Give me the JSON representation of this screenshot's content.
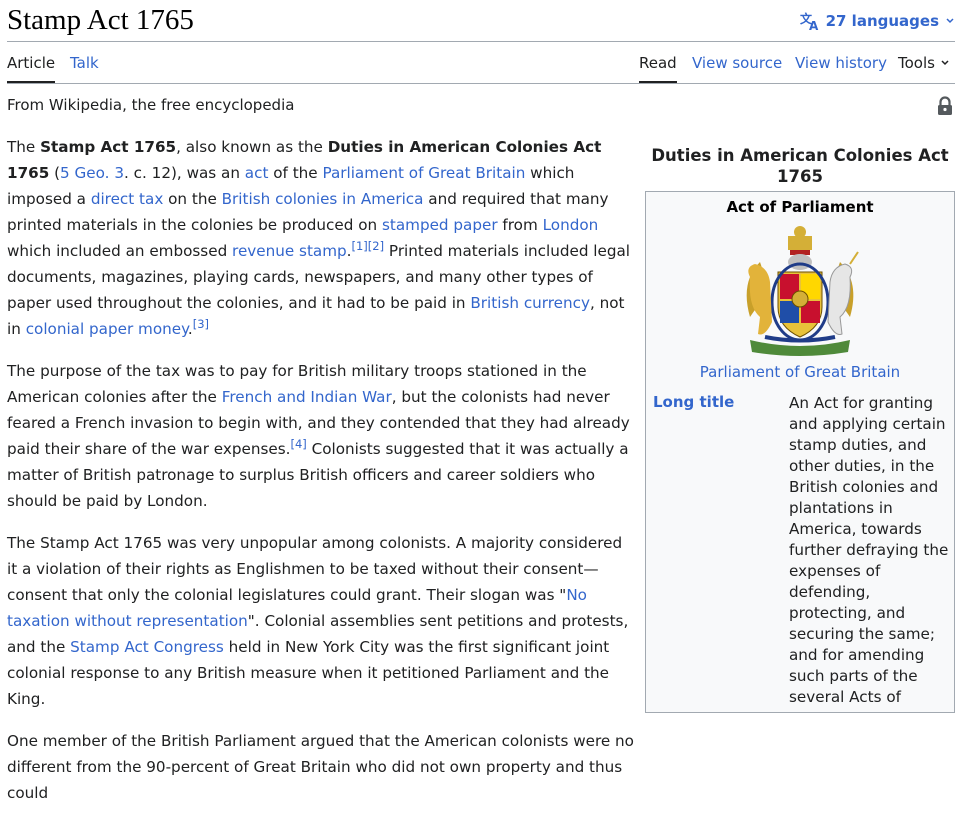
{
  "header": {
    "title": "Stamp Act 1765",
    "languages_label": "27 languages"
  },
  "tabs": {
    "article": "Article",
    "talk": "Talk",
    "read": "Read",
    "view_source": "View source",
    "view_history": "View history",
    "tools": "Tools"
  },
  "tagline": "From Wikipedia, the free encyclopedia",
  "icons": {
    "translate": "translate-icon",
    "chevron": "chevron-down-icon",
    "lock": "lock-icon",
    "coat_of_arms": "coat-of-arms-icon"
  },
  "colors": {
    "link": "#3366cc",
    "text": "#202122",
    "border": "#a2a9b1",
    "infobox_bg": "#f8f9fa"
  },
  "article": {
    "p1": [
      {
        "t": "The "
      },
      {
        "t": "Stamp Act 1765",
        "b": true
      },
      {
        "t": ", also known as the "
      },
      {
        "t": "Duties in American Colonies Act 1765",
        "b": true
      },
      {
        "t": " ("
      },
      {
        "t": "5 Geo. 3",
        "l": true
      },
      {
        "t": ". c. 12), was an "
      },
      {
        "t": "act",
        "l": true
      },
      {
        "t": " of the "
      },
      {
        "t": "Parliament of Great Britain",
        "l": true
      },
      {
        "t": " which imposed a "
      },
      {
        "t": "direct tax",
        "l": true
      },
      {
        "t": " on the "
      },
      {
        "t": "British colonies in America",
        "l": true
      },
      {
        "t": " and required that many printed materials in the colonies be produced on "
      },
      {
        "t": "stamped paper",
        "l": true
      },
      {
        "t": " from "
      },
      {
        "t": "London",
        "l": true
      },
      {
        "t": " which included an embossed "
      },
      {
        "t": "revenue stamp",
        "l": true
      },
      {
        "t": "."
      },
      {
        "t": "[1]",
        "sup": true
      },
      {
        "t": "[2]",
        "sup": true
      },
      {
        "t": " Printed materials included legal documents, magazines, playing cards, newspapers, and many other types of paper used throughout the colonies, and it had to be paid in "
      },
      {
        "t": "British currency",
        "l": true
      },
      {
        "t": ", not in "
      },
      {
        "t": "colonial paper money",
        "l": true
      },
      {
        "t": "."
      },
      {
        "t": "[3]",
        "sup": true
      }
    ],
    "p2": [
      {
        "t": "The purpose of the tax was to pay for British military troops stationed in the American colonies after the "
      },
      {
        "t": "French and Indian War",
        "l": true
      },
      {
        "t": ", but the colonists had never feared a French invasion to begin with, and they contended that they had already paid their share of the war expenses."
      },
      {
        "t": "[4]",
        "sup": true
      },
      {
        "t": " Colonists suggested that it was actually a matter of British patronage to surplus British officers and career soldiers who should be paid by London."
      }
    ],
    "p3": [
      {
        "t": "The Stamp Act 1765 was very unpopular among colonists. A majority considered it a violation of their rights as Englishmen to be taxed without their consent—consent that only the colonial legislatures could grant. Their slogan was \""
      },
      {
        "t": "No taxation without representation",
        "l": true
      },
      {
        "t": "\". Colonial assemblies sent petitions and protests, and the "
      },
      {
        "t": "Stamp Act Congress",
        "l": true
      },
      {
        "t": " held in New York City was the first significant joint colonial response to any British measure when it petitioned Parliament and the King."
      }
    ],
    "p4": [
      {
        "t": "One member of the British Parliament argued that the American colonists were no different from the 90-percent of Great Britain who did not own property and thus could"
      }
    ]
  },
  "infobox": {
    "caption": "Duties in American Colonies Act 1765",
    "subheader": "Act of Parliament",
    "arms_caption": "Parliament of Great Britain",
    "long_title_label": "Long title",
    "long_title_value": "An Act for granting and applying certain stamp duties, and other duties, in the British colonies and plantations in America, towards further defraying the expenses of defending, protecting, and securing the same; and for amending such parts of the several Acts of"
  }
}
